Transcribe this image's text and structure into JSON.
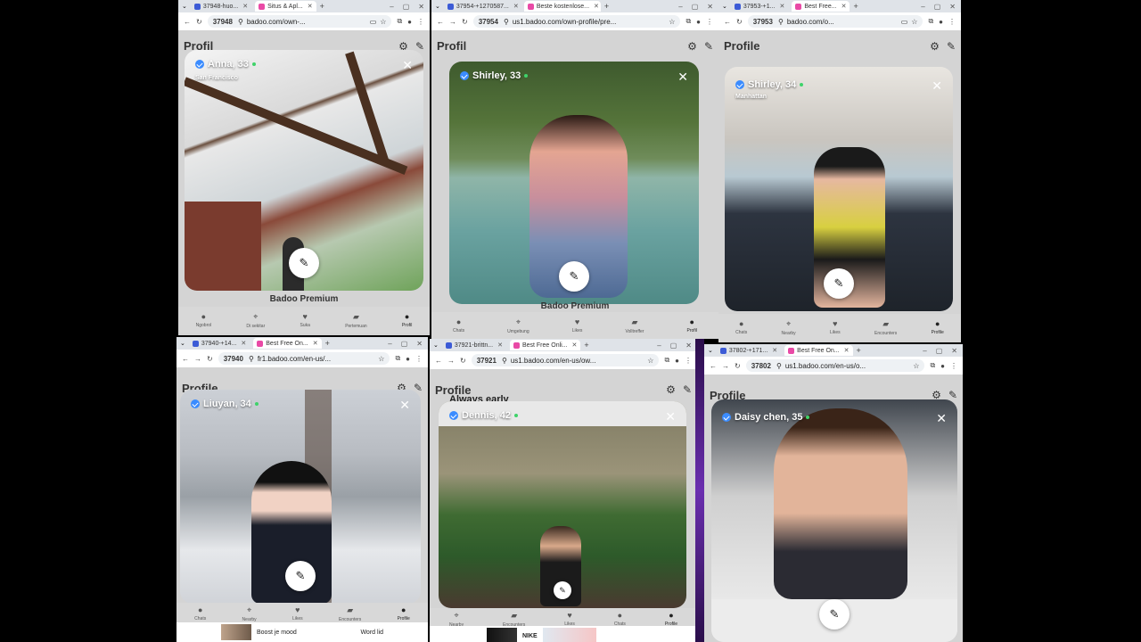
{
  "windows": [
    {
      "tabs": [
        {
          "label": "37948-huo..."
        },
        {
          "label": "Situs & Apl..."
        }
      ],
      "tab_number": "37948",
      "url": "badoo.com/own-...",
      "page_title": "Profil",
      "card": {
        "name": "Anna, 33",
        "location": "San Francisco"
      },
      "premium": "Badoo Premium",
      "nav": [
        "Ngobrol",
        "Di sekitar",
        "Suka",
        "Pertemuan",
        "Profil"
      ]
    },
    {
      "tabs": [
        {
          "label": "37954-+1270587..."
        },
        {
          "label": "Beste kostenlose..."
        }
      ],
      "tab_number": "37954",
      "url": "us1.badoo.com/own-profile/pre...",
      "page_title": "Profil",
      "card": {
        "name": "Shirley, 33",
        "location": ""
      },
      "premium": "Badoo Premium",
      "nav": [
        "Chats",
        "Umgebung",
        "Likes",
        "Volltreffer",
        "Profil"
      ]
    },
    {
      "tabs": [
        {
          "label": "37953-+1..."
        },
        {
          "label": "Best Free..."
        }
      ],
      "tab_number": "37953",
      "url": "badoo.com/o...",
      "page_title": "Profile",
      "card": {
        "name": "Shirley, 34",
        "location": "Manhattan"
      },
      "premium": "",
      "nav": [
        "Chats",
        "Nearby",
        "Likes",
        "Encounters",
        "Profile"
      ]
    },
    {
      "tabs": [
        {
          "label": "37940-+14..."
        },
        {
          "label": "Best Free On..."
        }
      ],
      "tab_number": "37940",
      "url": "fr1.badoo.com/en-us/...",
      "page_title": "Profile",
      "card": {
        "name": "Liuyan, 34",
        "location": ""
      },
      "premium": "",
      "nav": [
        "Chats",
        "Nearby",
        "Likes",
        "Encounters",
        "Profile"
      ],
      "ad": {
        "title": "Boost je mood",
        "sub": "Word lid"
      }
    },
    {
      "tabs": [
        {
          "label": "37921-brittn..."
        },
        {
          "label": "Best Free Onli..."
        }
      ],
      "tab_number": "37921",
      "url": "us1.badoo.com/en-us/ow...",
      "page_title": "Profile",
      "card": {
        "name": "Dennis, 42",
        "location": "",
        "headline": "Always early"
      },
      "premium": "",
      "nav": [
        "Nearby",
        "Encounters",
        "Likes",
        "Chats",
        "Profile"
      ],
      "ad": {
        "title": "NIKE",
        "sub": ""
      }
    },
    {
      "tabs": [
        {
          "label": "37802-+171..."
        },
        {
          "label": "Best Free On..."
        }
      ],
      "tab_number": "37802",
      "url": "us1.badoo.com/en-us/o...",
      "page_title": "Profile",
      "card": {
        "name": "Daisy chen, 35",
        "location": ""
      },
      "premium": "",
      "nav": []
    }
  ],
  "colors": {
    "verified": "#3b8cff",
    "online": "#3fd36a",
    "badoo_fav": "#e94aa6",
    "chrome_fav": "#3c5bd6"
  }
}
